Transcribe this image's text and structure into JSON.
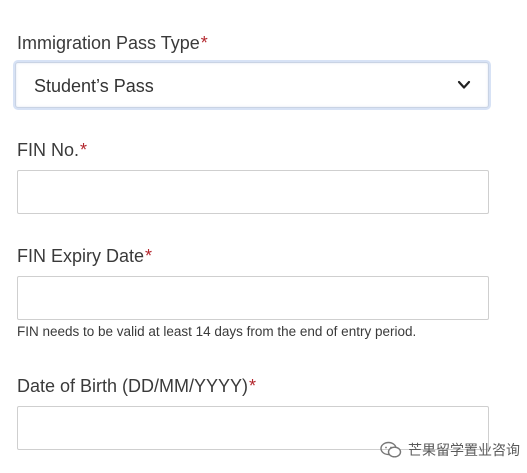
{
  "form": {
    "pass_type": {
      "label": "Immigration Pass Type",
      "required_mark": "*",
      "selected_value": "Student’s Pass"
    },
    "fin_no": {
      "label": "FIN No.",
      "required_mark": "*",
      "value": "",
      "placeholder": ""
    },
    "fin_expiry": {
      "label": "FIN Expiry Date",
      "required_mark": "*",
      "value": "",
      "placeholder": "",
      "hint": "FIN needs to be valid at least 14 days from the end of entry period."
    },
    "dob": {
      "label": "Date of Birth (DD/MM/YYYY)",
      "required_mark": "*",
      "value": "",
      "placeholder": ""
    }
  },
  "watermark": {
    "icon": "wechat-icon",
    "text": "芒果留学置业咨询"
  },
  "colors": {
    "required": "#b3262d",
    "select_focus_ring": "#d7e2f5"
  }
}
